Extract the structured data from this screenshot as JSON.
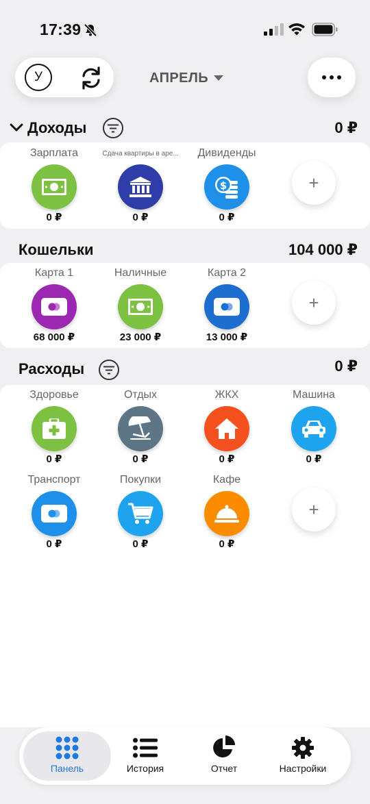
{
  "status_bar": {
    "time": "17:39"
  },
  "header": {
    "user_initial": "У",
    "month": "АПРЕЛЬ"
  },
  "income": {
    "title": "Доходы",
    "total": "0 ₽",
    "items": [
      {
        "label": "Зарплата",
        "value": "0 ₽",
        "icon": "banknote-icon",
        "color": "#7cc142"
      },
      {
        "label": "Сдача квартиры в аре...",
        "value": "0 ₽",
        "icon": "bank-icon",
        "color": "#2f3da8"
      },
      {
        "label": "Дивиденды",
        "value": "0 ₽",
        "icon": "coins-icon",
        "color": "#1e90ea"
      }
    ]
  },
  "wallets": {
    "title": "Кошельки",
    "total": "104 000 ₽",
    "items": [
      {
        "label": "Карта 1",
        "value": "68 000 ₽",
        "icon": "card-icon",
        "color": "#9c27b0"
      },
      {
        "label": "Наличные",
        "value": "23 000 ₽",
        "icon": "banknote-icon",
        "color": "#7cc142"
      },
      {
        "label": "Карта 2",
        "value": "13 000 ₽",
        "icon": "card-icon",
        "color": "#1c6fd1"
      }
    ]
  },
  "expenses": {
    "title": "Расходы",
    "total": "0 ₽",
    "items": [
      {
        "label": "Здоровье",
        "value": "0 ₽",
        "icon": "first-aid-icon",
        "color": "#7cc142"
      },
      {
        "label": "Отдых",
        "value": "0 ₽",
        "icon": "beach-umbrella-icon",
        "color": "#5c7686"
      },
      {
        "label": "ЖКХ",
        "value": "0 ₽",
        "icon": "house-icon",
        "color": "#f4511e"
      },
      {
        "label": "Машина",
        "value": "0 ₽",
        "icon": "car-icon",
        "color": "#1ea4ee"
      },
      {
        "label": "Транспорт",
        "value": "0 ₽",
        "icon": "card-icon",
        "color": "#1e90ea"
      },
      {
        "label": "Покупки",
        "value": "0 ₽",
        "icon": "cart-icon",
        "color": "#1ea4ee"
      },
      {
        "label": "Кафе",
        "value": "0 ₽",
        "icon": "cloche-icon",
        "color": "#fb8c00"
      }
    ]
  },
  "add_label": "+",
  "tabs": [
    {
      "label": "Панель",
      "icon": "grid-icon",
      "active": true
    },
    {
      "label": "История",
      "icon": "list-icon",
      "active": false
    },
    {
      "label": "Отчет",
      "icon": "pie-chart-icon",
      "active": false
    },
    {
      "label": "Настройки",
      "icon": "gear-icon",
      "active": false
    }
  ],
  "colors": {
    "accent": "#1f7ae0",
    "background": "#f0f0f2"
  }
}
